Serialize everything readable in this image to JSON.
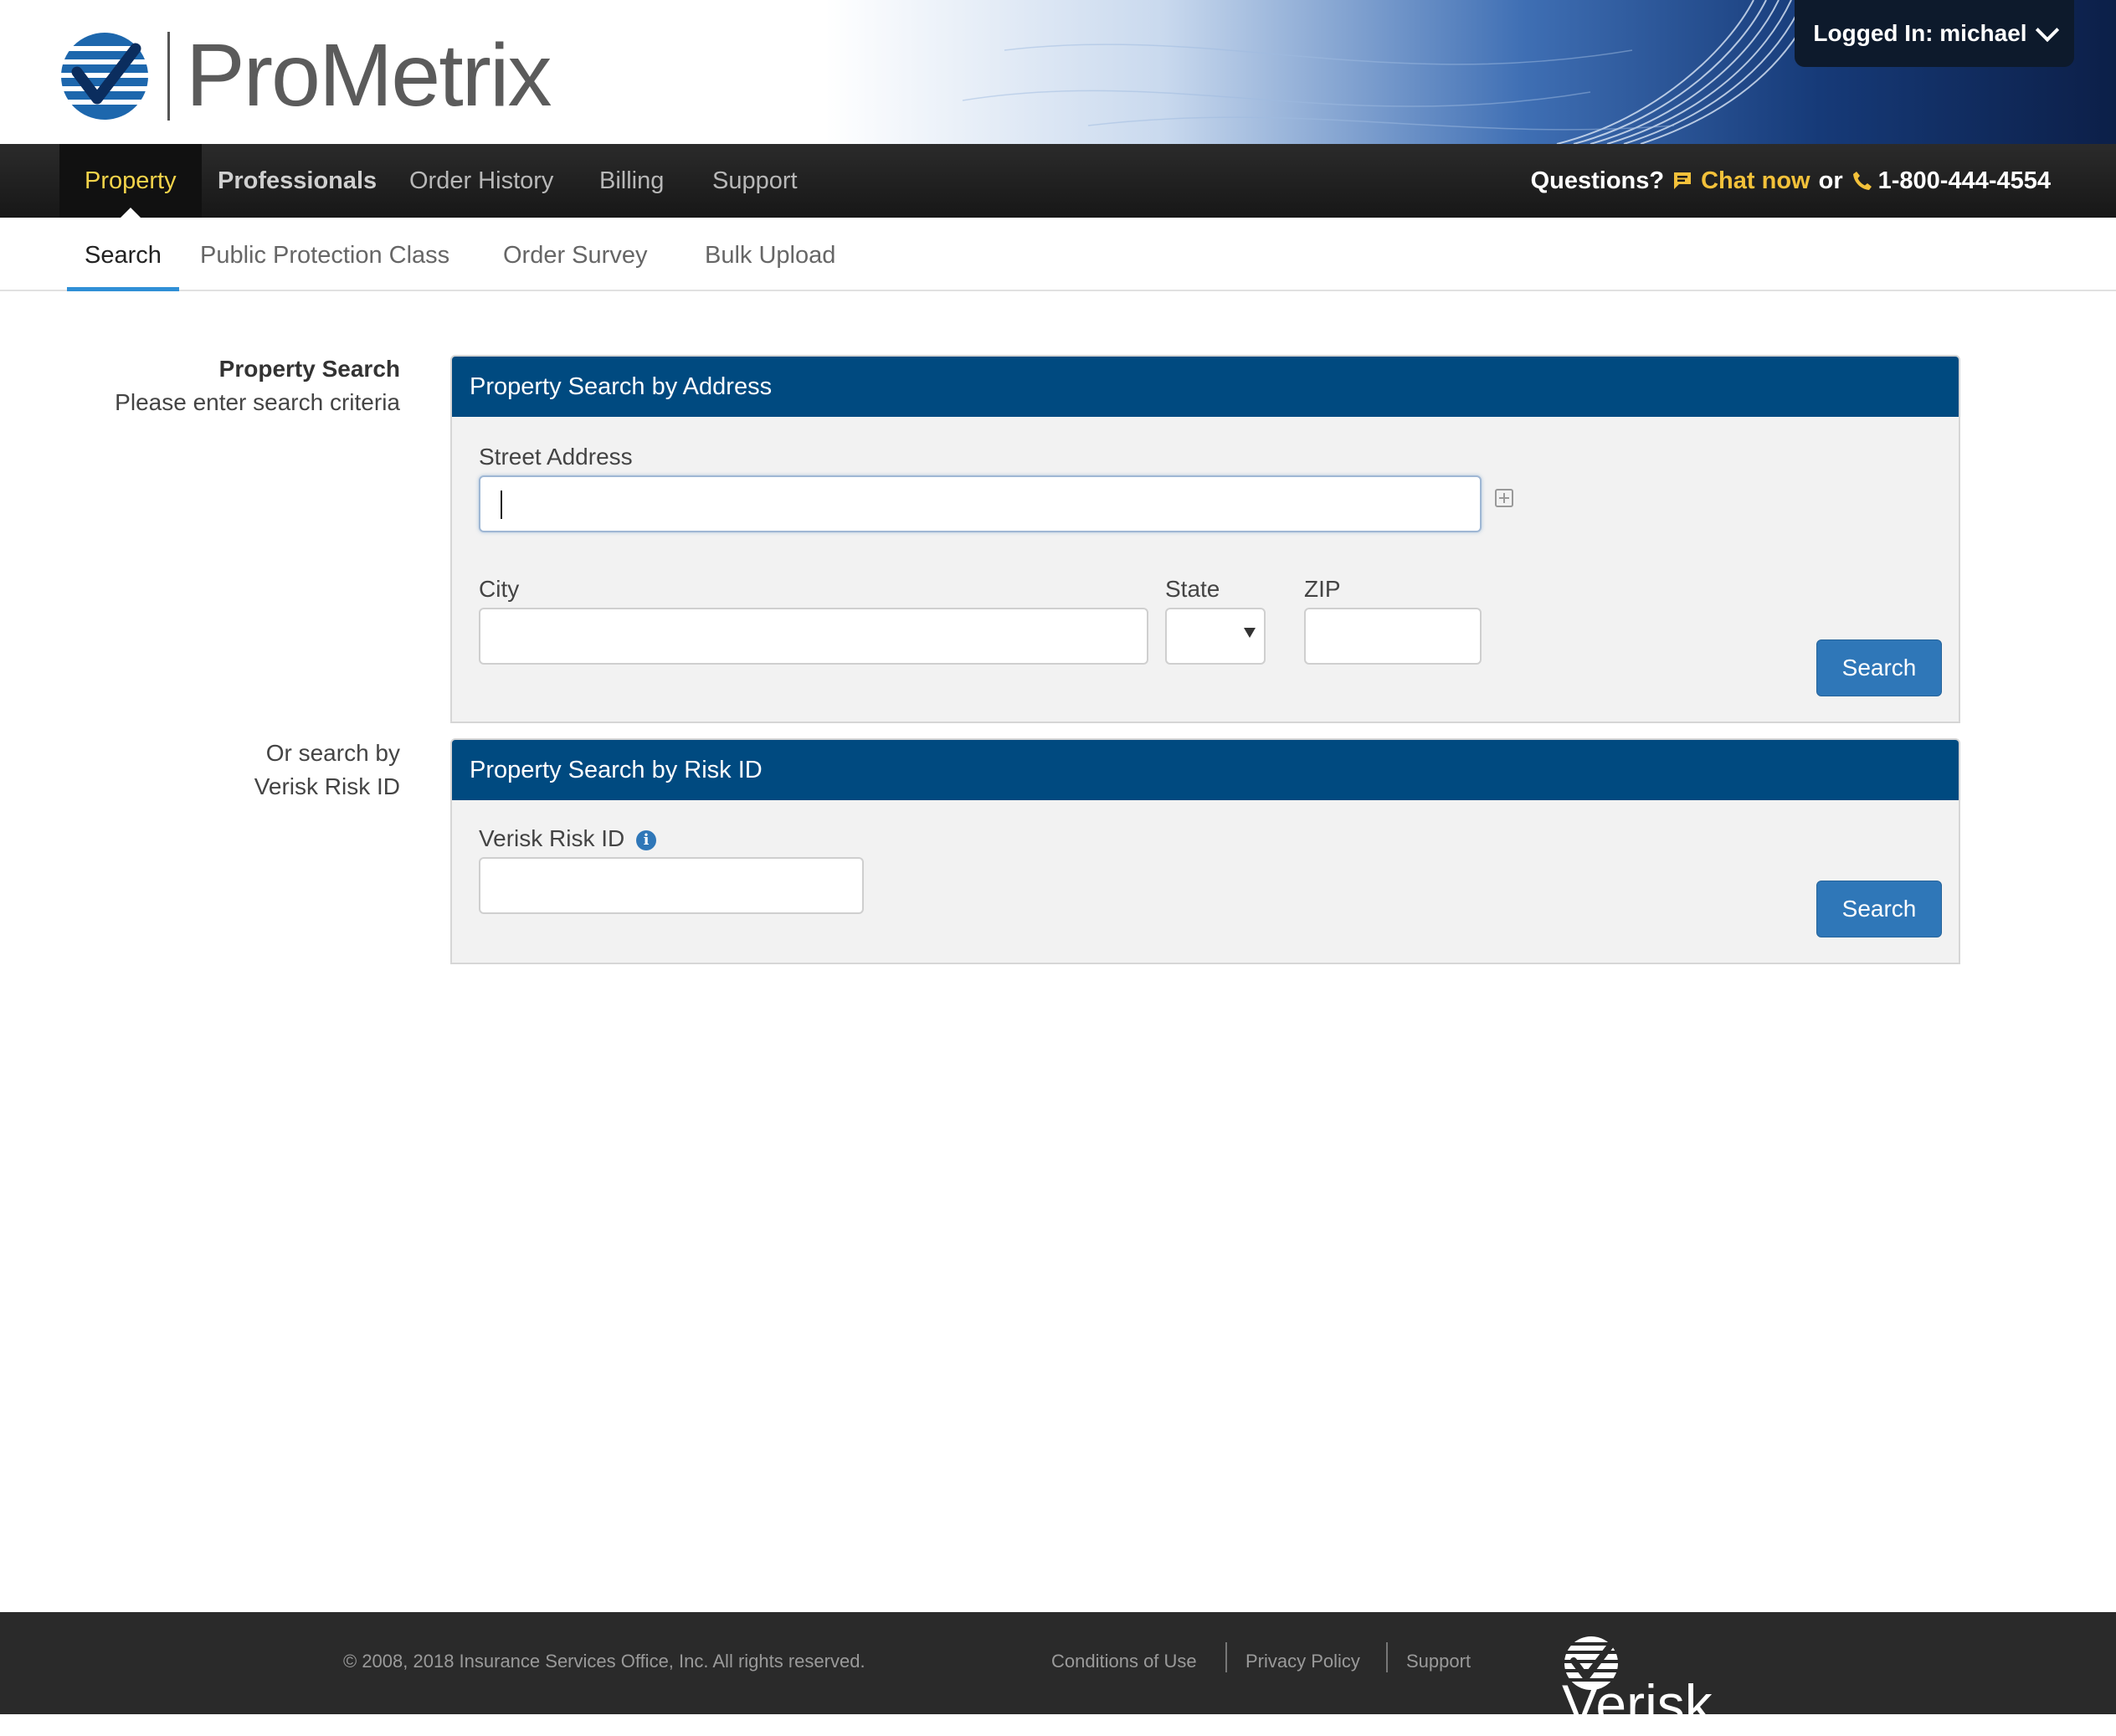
{
  "brand": {
    "name": "ProMetrix",
    "accent": "#f3d34a",
    "primary": "#004a80"
  },
  "user_menu": {
    "label": "Logged In: michael",
    "icon": "chevron-down-icon"
  },
  "main_nav": {
    "items": [
      {
        "label": "Property",
        "active": true
      },
      {
        "label": "Professionals"
      },
      {
        "label": "Order History"
      },
      {
        "label": "Billing"
      },
      {
        "label": "Support"
      }
    ],
    "questions": "Questions?",
    "chat": "Chat now",
    "or": "or",
    "phone": "1-800-444-4554"
  },
  "sub_nav": {
    "items": [
      {
        "label": "Search",
        "active": true
      },
      {
        "label": "Public Protection Class"
      },
      {
        "label": "Order Survey"
      },
      {
        "label": "Bulk Upload"
      }
    ]
  },
  "side": {
    "title": "Property Search",
    "subtitle": "Please enter search criteria",
    "or_line1": "Or search by",
    "or_line2": "Verisk Risk ID"
  },
  "address_panel": {
    "title": "Property Search by Address",
    "street_label": "Street Address",
    "street_value": "",
    "city_label": "City",
    "city_value": "",
    "state_label": "State",
    "state_value": "",
    "zip_label": "ZIP",
    "zip_value": "",
    "search_button": "Search"
  },
  "risk_panel": {
    "title": "Property Search by Risk ID",
    "risk_label": "Verisk Risk ID",
    "risk_value": "",
    "search_button": "Search"
  },
  "footer": {
    "copyright": "© 2008, 2018 Insurance Services Office, Inc. All rights reserved.",
    "links": [
      "Conditions of Use",
      "Privacy Policy",
      "Support"
    ],
    "logo_text": "Verisk"
  }
}
